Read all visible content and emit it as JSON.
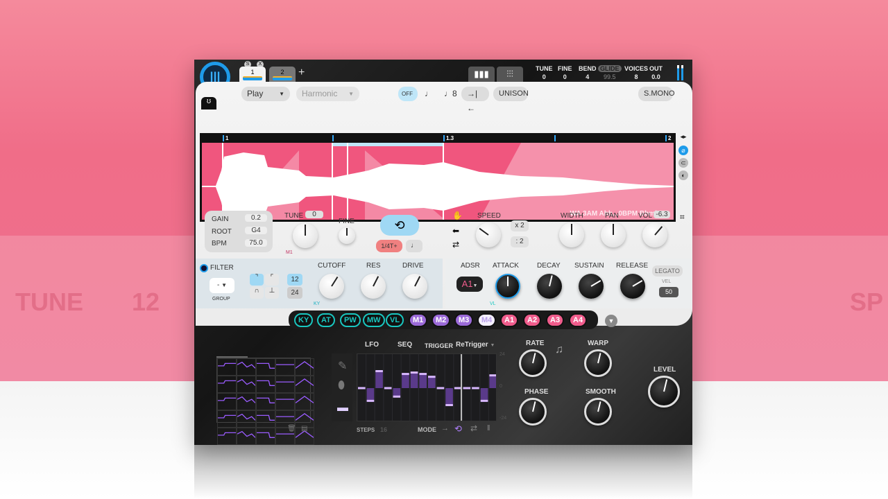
{
  "background": {
    "ghost_left": "TUNE",
    "ghost_num": "12",
    "ghost_right": "SP"
  },
  "colors": {
    "accent": "#1e9bea",
    "waveform_bg": "#f0567e",
    "mod_teal": "#19c7c0",
    "mod_purple": "#9b6ad8",
    "mod_pink": "#f05c8c"
  },
  "header": {
    "tabs": [
      {
        "label": "1",
        "active": true
      },
      {
        "label": "2",
        "active": false
      }
    ],
    "tab_solo": "S",
    "tab_close": "X",
    "add_tab": "+",
    "readouts": [
      {
        "label": "TUNE",
        "value": "0"
      },
      {
        "label": "FINE",
        "value": "0"
      },
      {
        "label": "BEND",
        "value": "4"
      },
      {
        "label": "GLIDE",
        "value": "99.5"
      },
      {
        "label": "VOICES",
        "value": "8"
      },
      {
        "label": "OUT",
        "value": "0.0"
      }
    ]
  },
  "toolbar": {
    "mode": "Play",
    "harmonic": "Harmonic",
    "off": "OFF",
    "unison": "UNISON",
    "smono": "S.MONO"
  },
  "waveform": {
    "markers": [
      "1",
      "1.3",
      "2"
    ],
    "sample_name": "WA 3AM Ahh...0BPM Bbmin"
  },
  "main": {
    "gain_label": "GAIN",
    "gain": "0.2",
    "root_label": "ROOT",
    "root": "G4",
    "bpm_label": "BPM",
    "bpm": "75.0",
    "tune_label": "TUNE",
    "tune": "0",
    "fine_label": "FINE",
    "tune_mod": "M1",
    "rate_label": "1/4T+",
    "speed_label": "SPEED",
    "x2": "x 2",
    "div2": ": 2",
    "width_label": "WIDTH",
    "pan_label": "PAN",
    "vol_label": "VOL",
    "vol": "-6.3",
    "knobs": {
      "tune": 0.5,
      "fine": 0.5,
      "speed": 0.3,
      "width": 0.5,
      "pan": 0.5,
      "vol": 0.65
    }
  },
  "filter": {
    "label": "FILTER",
    "group_value": "-",
    "group_label": "GROUP",
    "slope_12": "12",
    "slope_24": "24",
    "cutoff_label": "CUTOFF",
    "res_label": "RES",
    "drive_label": "DRIVE",
    "cutoff_mod": "KY",
    "knobs": {
      "cutoff": 0.62,
      "res": 0.6,
      "drive": 0.6
    }
  },
  "adsr": {
    "label": "ADSR",
    "env": "A1",
    "attack_label": "ATTACK",
    "decay_label": "DECAY",
    "sustain_label": "SUSTAIN",
    "release_label": "RELEASE",
    "legato": "LEGATO",
    "vel_label": "VEL",
    "vel": "50",
    "attack_mod": "VL",
    "knobs": {
      "attack": 0.5,
      "decay": 0.55,
      "sustain": 0.72,
      "release": 0.72
    }
  },
  "mod_sources": [
    "KY",
    "AT",
    "PW",
    "MW",
    "VL",
    "M1",
    "M2",
    "M3",
    "M4",
    "A1",
    "A2",
    "A3",
    "A4"
  ],
  "lfo": {
    "lfo_label": "LFO",
    "seq_label": "SEQ",
    "trigger_label": "TRIGGER",
    "trigger": "ReTrigger",
    "steps_label": "STEPS",
    "steps": "16",
    "mode_label": "MODE",
    "range_top": "24",
    "range_mid": "0",
    "range_bot": "-24",
    "seq_values": [
      0,
      -9,
      12,
      0,
      -6,
      10,
      11,
      10,
      8,
      0,
      -12,
      0,
      0,
      0,
      -9,
      9
    ],
    "rate_label": "RATE",
    "warp_label": "WARP",
    "phase_label": "PHASE",
    "smooth_label": "SMOOTH",
    "level_label": "LEVEL",
    "knobs": {
      "rate": 0.55,
      "warp": 0.55,
      "phase": 0.55,
      "smooth": 0.55,
      "level": 0.55
    }
  }
}
